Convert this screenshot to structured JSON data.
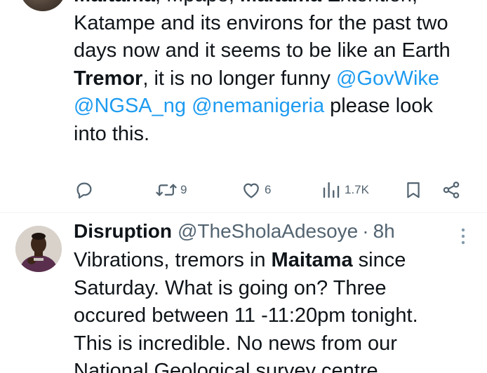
{
  "tweet1": {
    "lines": [
      [
        {
          "t": "Maitama",
          "s": "bold"
        },
        {
          "t": ", Mpape, "
        },
        {
          "t": "Maitama",
          "s": "bold"
        },
        {
          "t": " Extention,"
        }
      ],
      [
        {
          "t": "Katampe and its environs for the past two"
        }
      ],
      [
        {
          "t": "days now and it seems to be like an Earth"
        }
      ],
      [
        {
          "t": "Tremor",
          "s": "bold"
        },
        {
          "t": ", it is no longer funny "
        },
        {
          "t": "@GovWike",
          "s": "mention"
        }
      ],
      [
        {
          "t": "@NGSA_ng",
          "s": "mention"
        },
        {
          "t": " "
        },
        {
          "t": "@nemanigeria",
          "s": "mention"
        },
        {
          "t": " please look"
        }
      ],
      [
        {
          "t": "into this."
        }
      ]
    ],
    "actions": {
      "reply_icon": "reply-icon",
      "retweet_icon": "retweet-icon",
      "retweet_count": "9",
      "like_icon": "heart-icon",
      "like_count": "6",
      "views_icon": "views-icon",
      "views_count": "1.7K",
      "bookmark_icon": "bookmark-icon",
      "share_icon": "share-icon"
    }
  },
  "tweet2": {
    "display_name": "Disruption",
    "handle": "@TheSholaAdesoye",
    "separator": "·",
    "time": "8h",
    "more_icon": "more-vertical-icon",
    "lines": [
      [
        {
          "t": "Vibrations, tremors in "
        },
        {
          "t": "Maitama",
          "s": "bold"
        },
        {
          "t": " since"
        }
      ],
      [
        {
          "t": "Saturday. What is going on? Three"
        }
      ],
      [
        {
          "t": "occured between 11 -11:20pm tonight."
        }
      ],
      [
        {
          "t": "This is incredible. No news from our"
        }
      ],
      [
        {
          "t": "National Geological survey centre"
        }
      ]
    ]
  },
  "colors": {
    "text": "#0f1419",
    "secondary": "#536471",
    "mention": "#1d9bf0",
    "divider": "#eff3f4"
  }
}
